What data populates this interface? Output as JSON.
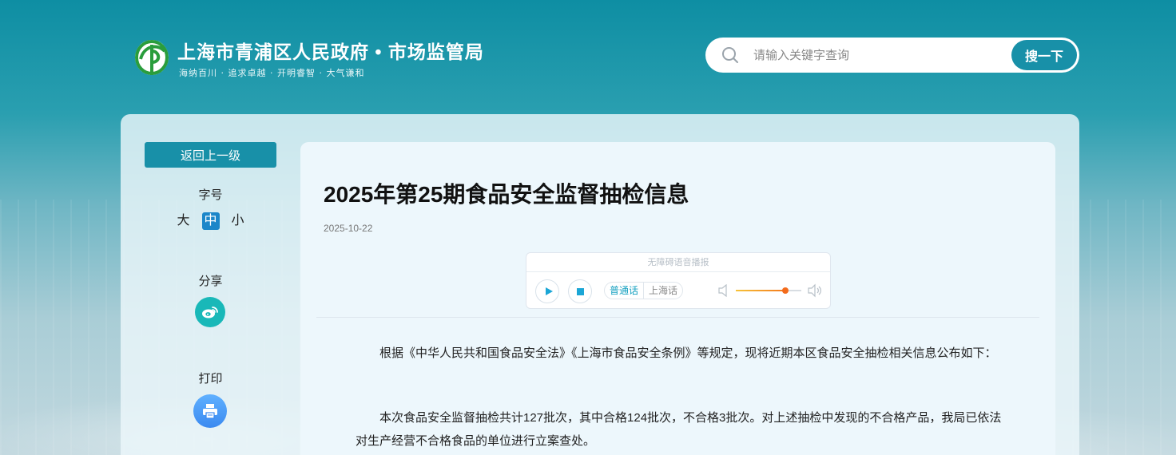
{
  "header": {
    "site_title": "上海市青浦区人民政府 • 市场监管局",
    "motto": "海纳百川 · 追求卓越 · 开明睿智 · 大气谦和",
    "search": {
      "placeholder": "请输入关键字查询",
      "button_label": "搜一下"
    }
  },
  "sidebar": {
    "back_label": "返回上一级",
    "font_size_label": "字号",
    "font_size_options": [
      "大",
      "中",
      "小"
    ],
    "font_size_selected": "中",
    "share_label": "分享",
    "print_label": "打印"
  },
  "article": {
    "title": "2025年第25期食品安全监督抽检信息",
    "date": "2025-10-22",
    "player": {
      "title": "无障碍语音播报",
      "languages": [
        "普通话",
        "上海话"
      ],
      "selected_language": "普通话",
      "volume": 0.75
    },
    "paragraphs": [
      "根据《中华人民共和国食品安全法》《上海市食品安全条例》等规定，现将近期本区食品安全抽检相关信息公布如下：",
      "本次食品安全监督抽检共计127批次，其中合格124批次，不合格3批次。对上述抽检中发现的不合格产品，我局已依法对生产经营不合格食品的单位进行立案查处。"
    ]
  },
  "colors": {
    "accent": "#1890a8",
    "active_font": "#1b86c9",
    "weibo": "#19b8b8",
    "print": "#3b8af0"
  },
  "icons": [
    "logo-icon",
    "search-icon",
    "weibo-icon",
    "print-icon",
    "play-icon",
    "stop-icon",
    "volume-low-icon",
    "volume-high-icon"
  ]
}
